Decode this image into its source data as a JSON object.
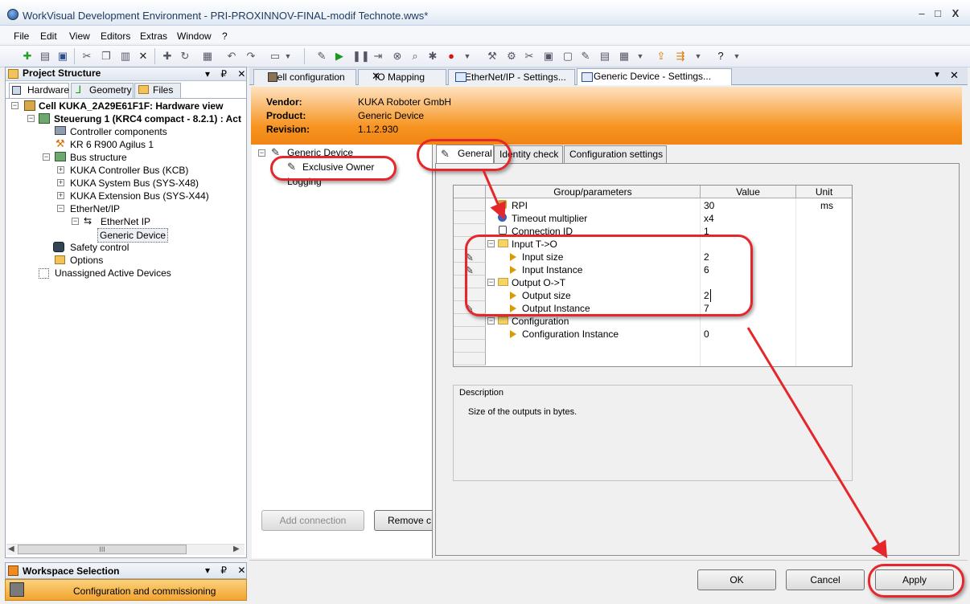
{
  "window": {
    "title": "WorkVisual Development Environment - PRI-PROXINNOV-FINAL-modif Technote.wws*",
    "minimize_glyph": "–",
    "maximize_glyph": "□",
    "close_glyph": "X"
  },
  "menu": [
    "File",
    "Edit",
    "View",
    "Editors",
    "Extras",
    "Window",
    "?"
  ],
  "project_structure": {
    "title": "Project Structure",
    "pin_glyph": "▾ ₽ ✕",
    "tabs": [
      "Hardware",
      "Geometry",
      "Files"
    ],
    "tree": [
      {
        "label": "Cell KUKA_2A29E61F1F: Hardware view",
        "bold": true
      },
      {
        "label": "Steuerung 1 (KRC4 compact - 8.2.1) : Act",
        "bold": true
      },
      {
        "label": "Controller components"
      },
      {
        "label": "KR 6 R900 Agilus 1"
      },
      {
        "label": "Bus structure"
      },
      {
        "label": "KUKA Controller Bus (KCB)"
      },
      {
        "label": "KUKA System Bus (SYS-X48)"
      },
      {
        "label": "KUKA Extension Bus (SYS-X44)"
      },
      {
        "label": "EtherNet/IP"
      },
      {
        "label": "EtherNet IP"
      },
      {
        "label": "Generic Device"
      },
      {
        "label": "Safety control"
      },
      {
        "label": "Options"
      },
      {
        "label": "Unassigned Active Devices"
      }
    ],
    "scroll_glyph": "III"
  },
  "workspace": {
    "title": "Workspace Selection",
    "selected": "Configuration and commissioning"
  },
  "doc_tabs": [
    "Cell configuration",
    "IO Mapping",
    "EtherNet/IP - Settings...",
    "Generic Device - Settings..."
  ],
  "device": {
    "vendor_label": "Vendor:",
    "vendor": "KUKA Roboter GmbH",
    "product_label": "Product:",
    "product": "Generic Device",
    "revision_label": "Revision:",
    "revision": "1.1.2.930"
  },
  "connections": {
    "tree": [
      "Generic Device",
      "Exclusive Owner",
      "Logging"
    ],
    "add_button": "Add connection",
    "remove_button": "Remove c"
  },
  "settings_tabs": [
    "General",
    "Identity check",
    "Configuration settings"
  ],
  "grid": {
    "headers": [
      "Group/parameters",
      "Value",
      "Unit"
    ],
    "rows": [
      {
        "name": "RPI",
        "value": "30",
        "unit": "ms"
      },
      {
        "name": "Timeout multiplier",
        "value": "x4",
        "unit": ""
      },
      {
        "name": "Connection ID",
        "value": "1",
        "unit": ""
      },
      {
        "name": "Input T->O",
        "value": "",
        "unit": ""
      },
      {
        "name": "Input size",
        "value": "2",
        "unit": ""
      },
      {
        "name": "Input Instance",
        "value": "6",
        "unit": ""
      },
      {
        "name": "Output O->T",
        "value": "",
        "unit": ""
      },
      {
        "name": "Output size",
        "value": "2",
        "unit": ""
      },
      {
        "name": "Output Instance",
        "value": "7",
        "unit": ""
      },
      {
        "name": "Configuration",
        "value": "",
        "unit": ""
      },
      {
        "name": "Configuration Instance",
        "value": "0",
        "unit": ""
      }
    ]
  },
  "description": {
    "title": "Description",
    "text": "Size of the outputs in bytes."
  },
  "dialog_buttons": {
    "ok": "OK",
    "cancel": "Cancel",
    "apply": "Apply"
  },
  "colors": {
    "annotation_red": "#e5262b",
    "header_orange": "#f7931e"
  }
}
